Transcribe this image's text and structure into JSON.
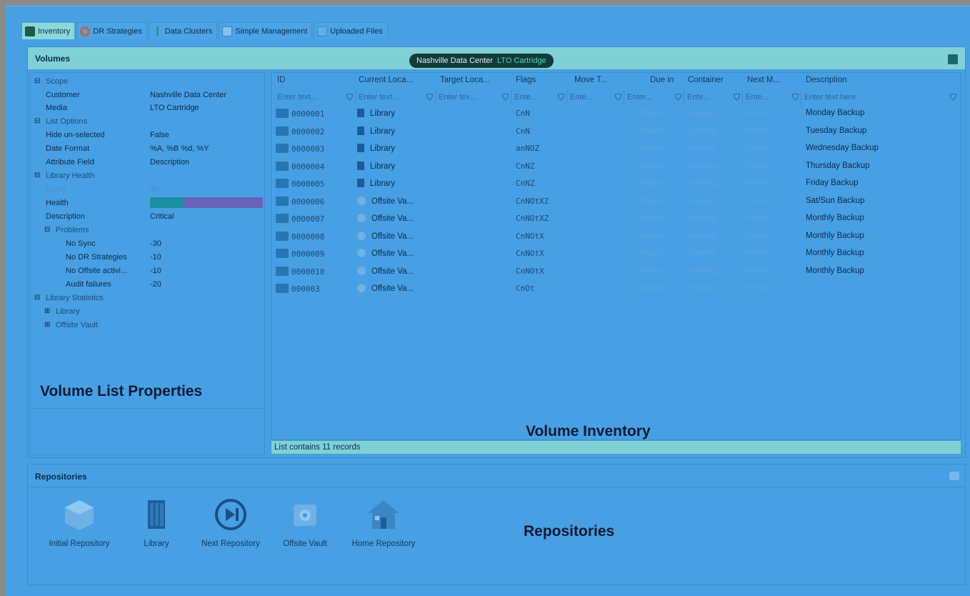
{
  "tabs": [
    {
      "label": "Inventory",
      "icon": "inventory-icon",
      "active": true
    },
    {
      "label": "DR Strategies",
      "icon": "dr-strategies-icon"
    },
    {
      "label": "Data Clusters",
      "icon": "data-clusters-icon"
    },
    {
      "label": "Simple Management",
      "icon": "simple-management-icon"
    },
    {
      "label": "Uploaded Files",
      "icon": "uploaded-files-icon"
    }
  ],
  "volumes": {
    "title": "Volumes",
    "crumb_location": "Nashville Data Center",
    "crumb_media": "LTO Cartridge"
  },
  "properties": {
    "scope": "Scope",
    "customer_name": "Customer",
    "customer_value": "Nashville Data Center",
    "media_name": "Media",
    "media_value": "LTO Cartridge",
    "list_options": "List Options",
    "hide_name": "Hide un-selected",
    "hide_value": "False",
    "date_name": "Date Format",
    "date_value": "%A, %B %d, %Y",
    "attr_name": "Attribute Field",
    "attr_value": "Description",
    "library_health": "Library Health",
    "score_name": "Score",
    "score_value": "30",
    "health_name": "Health",
    "desc_name": "Description",
    "desc_value": "Critical",
    "problems": "Problems",
    "nosync_name": "No Sync",
    "nosync_value": "-30",
    "nodr_name": "No DR Strategies",
    "nodr_value": "-10",
    "nooff_name": "No Offsite activi...",
    "nooff_value": "-10",
    "audit_name": "Audit failures",
    "audit_value": "-20",
    "library_statistics": "Library Statistics",
    "library": "Library",
    "offsite_vault": "Offsite Vault"
  },
  "health_colors": {
    "good": "#1b8fa0",
    "bad": "#6a62b8"
  },
  "labels": {
    "volume_list_properties": "Volume List Properties",
    "volume_inventory": "Volume Inventory",
    "repositories": "Repositories"
  },
  "grid": {
    "columns": [
      "ID",
      "Current Loca...",
      "Target Loca...",
      "Flags",
      "Move T...",
      "Due in",
      "Container",
      "Next M...",
      "Description"
    ],
    "filters": [
      "Enter text...",
      "Enter text...",
      "Enter tex...",
      "Ente...",
      "Ente...",
      "Enter...",
      "Ente...",
      "Ente...",
      "Enter text here"
    ],
    "rows": [
      {
        "id": "0000001",
        "loc": "Library",
        "flags": "CnN",
        "due": "Unspeci...",
        "cont": "Unassig...",
        "next": "Perma...",
        "desc": "Monday Backup"
      },
      {
        "id": "0000002",
        "loc": "Library",
        "flags": "CnN",
        "due": "Unspeci...",
        "cont": "Unassig...",
        "next": "Perma...",
        "desc": "Tuesday Backup"
      },
      {
        "id": "0000003",
        "loc": "Library",
        "flags": "anNOZ",
        "due": "Unspeci...",
        "cont": "Unassig...",
        "next": "Perma...",
        "desc": "Wednesday Backup"
      },
      {
        "id": "0000004",
        "loc": "Library",
        "flags": "CnNZ",
        "due": "Unspeci...",
        "cont": "Unassig...",
        "next": "Perma...",
        "desc": "Thursday Backup"
      },
      {
        "id": "0000005",
        "loc": "Library",
        "flags": "CnNZ",
        "due": "Unspeci...",
        "cont": "Unassig...",
        "next": "Perma...",
        "desc": "Friday Backup"
      },
      {
        "id": "0000006",
        "loc": "Offsite Va...",
        "flags": "CnNOtXZ",
        "due": "Unspeci...",
        "cont": "Unassig...",
        "next": "Perma...",
        "desc": "Sat/Sun Backup"
      },
      {
        "id": "0000007",
        "loc": "Offsite Va...",
        "flags": "CnNOtXZ",
        "due": "Unspeci...",
        "cont": "Unassig...",
        "next": "Perma...",
        "desc": "Monthly Backup"
      },
      {
        "id": "0000008",
        "loc": "Offsite Va...",
        "flags": "CnNOtX",
        "due": "Unspeci...",
        "cont": "Unassig...",
        "next": "Perma...",
        "desc": "Monthly Backup"
      },
      {
        "id": "0000009",
        "loc": "Offsite Va...",
        "flags": "CnNOtX",
        "due": "Unspeci...",
        "cont": "Unassig...",
        "next": "Perma...",
        "desc": "Monthly Backup"
      },
      {
        "id": "0000010",
        "loc": "Offsite Va...",
        "flags": "CnNOtX",
        "due": "Unspeci...",
        "cont": "Unassig...",
        "next": "Perma...",
        "desc": "Monthly Backup"
      },
      {
        "id": "000003",
        "loc": "Offsite Va...",
        "flags": "CnOt",
        "due": "Unspeci...",
        "cont": "Unassig...",
        "next": "Perma...",
        "desc": ""
      }
    ],
    "status": "List contains 11 records"
  },
  "repositories": {
    "title": "Repositories",
    "items": [
      {
        "label": "Initial Repository",
        "icon": "initial-repository-icon"
      },
      {
        "label": "Library",
        "icon": "library-icon"
      },
      {
        "label": "Next Repository",
        "icon": "next-repository-icon"
      },
      {
        "label": "Offsite Vault",
        "icon": "offsite-vault-icon"
      },
      {
        "label": "Home Repository",
        "icon": "home-repository-icon"
      }
    ]
  }
}
